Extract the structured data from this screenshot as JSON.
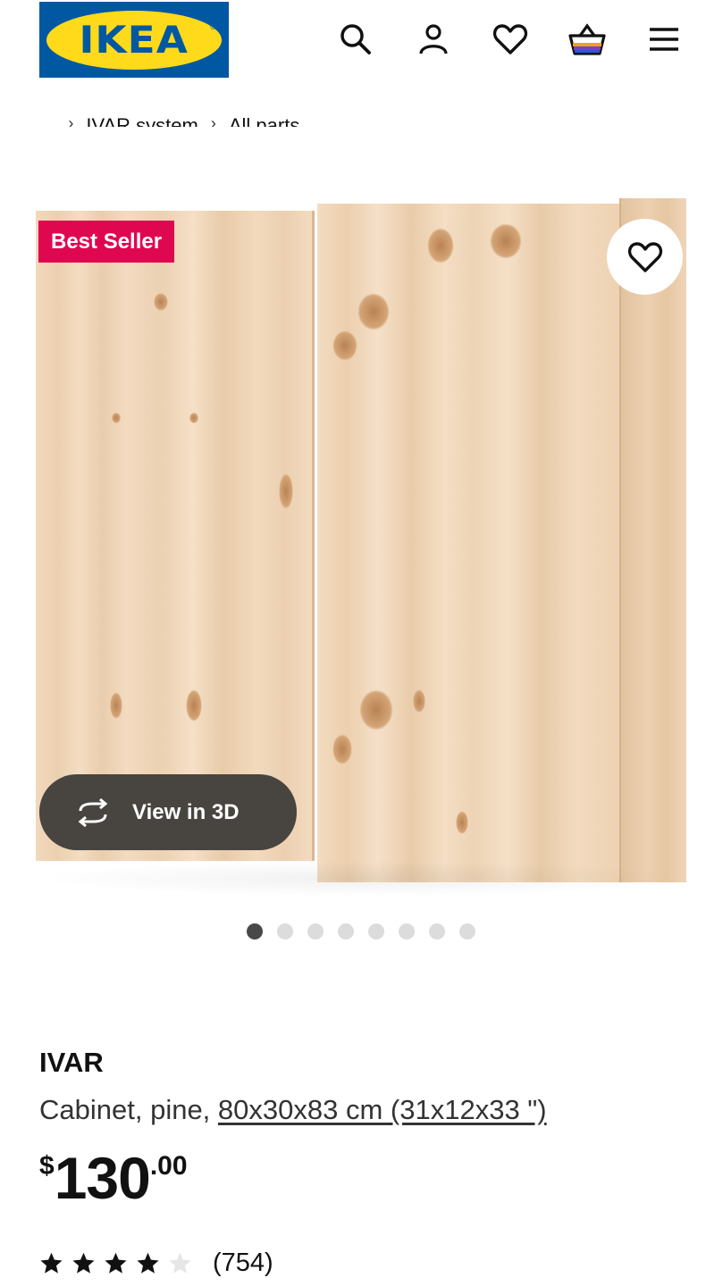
{
  "header": {
    "logo_text": "IKEA",
    "logo_reg": "®",
    "icons": [
      "search-icon",
      "user-icon",
      "heart-icon",
      "basket-icon",
      "menu-icon"
    ]
  },
  "breadcrumb": {
    "ellipsis": "...",
    "items": [
      "IVAR system",
      "All parts"
    ]
  },
  "product_image": {
    "badge": "Best Seller",
    "view_3d_label": "View in 3D",
    "carousel": {
      "total": 8,
      "active_index": 0
    }
  },
  "product": {
    "name": "IVAR",
    "description_prefix": "Cabinet, pine, ",
    "dimensions": "80x30x83 cm (31x12x33 \")",
    "price_currency": "$",
    "price_integer": "130",
    "price_decimal": ".00",
    "rating": {
      "value": 4,
      "max": 5
    },
    "review_count": "(754)"
  },
  "colors": {
    "ikea_blue": "#0058a3",
    "ikea_yellow": "#ffda1a",
    "badge_red": "#e00751",
    "view3d_bg": "#484440"
  }
}
